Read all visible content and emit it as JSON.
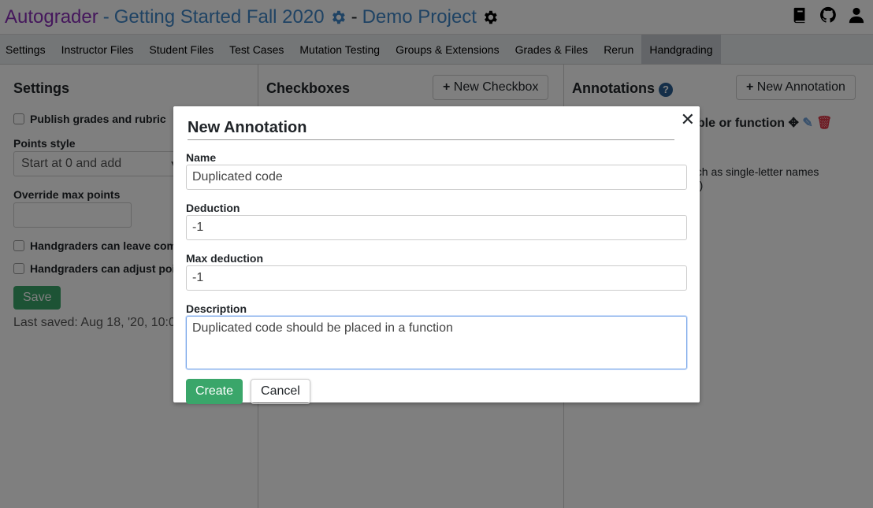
{
  "header": {
    "app": "Autograder",
    "sep1": "-",
    "course": "Getting Started Fall 2020",
    "sep2": "-",
    "project": "Demo Project",
    "icons": [
      "book-icon",
      "github-icon",
      "user-icon"
    ]
  },
  "nav": {
    "tabs": [
      "Settings",
      "Instructor Files",
      "Student Files",
      "Test Cases",
      "Mutation Testing",
      "Groups & Extensions",
      "Grades & Files",
      "Rerun",
      "Handgrading"
    ],
    "active": "Handgrading"
  },
  "settings": {
    "title": "Settings",
    "publish": "Publish grades and rubric",
    "points_style_label": "Points style",
    "points_style_value": "Start at 0 and add",
    "override_label": "Override max points",
    "override_value": "",
    "leave_comments": "Handgraders can leave com",
    "adjust_points": "Handgraders can adjust poi",
    "save": "Save",
    "last_saved": "Last saved: Aug 18, '20, 10:0"
  },
  "checkboxes": {
    "title": "Checkboxes",
    "new_button": "New Checkbox"
  },
  "annotations": {
    "title": "Annotations",
    "new_button": "New Annotation",
    "item_title": "able or function",
    "item_desc1": "uch as single-letter names",
    "item_desc2": "rs)"
  },
  "modal": {
    "title": "New Annotation",
    "name_label": "Name",
    "name_value": "Duplicated code",
    "deduction_label": "Deduction",
    "deduction_value": "-1",
    "max_deduction_label": "Max deduction",
    "max_deduction_value": "-1",
    "description_label": "Description",
    "description_value": "Duplicated code should be placed in a function",
    "create": "Create",
    "cancel": "Cancel"
  },
  "colors": {
    "app_title": "#8a2fb8",
    "link": "#3f86c8",
    "success": "#3aa66a",
    "danger": "#dc3545"
  }
}
